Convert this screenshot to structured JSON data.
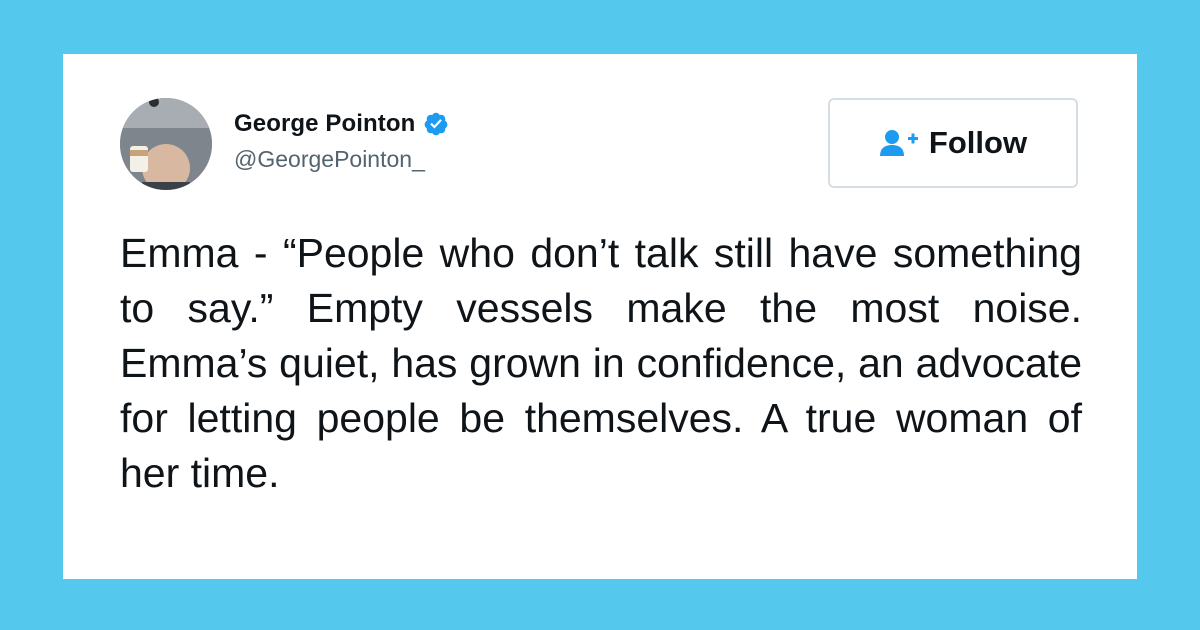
{
  "tweet": {
    "author": {
      "name": "George Pointon",
      "handle": "@GeorgePointon_",
      "verified": true,
      "avatar": "avatar-photo"
    },
    "follow_button": {
      "label": "Follow",
      "icon": "add-user-icon"
    },
    "text": "Emma - “People who don’t talk still have something to say.” Empty vessels make the most noise. Emma’s quiet, has grown in confidence, an advocate for letting people be themselves. A true woman of her time."
  },
  "colors": {
    "background": "#55c8ee",
    "card": "#ffffff",
    "verified_badge": "#1d9bf0",
    "follow_icon": "#1d9bf0",
    "text_primary": "#0f1419",
    "text_secondary": "#536471"
  }
}
